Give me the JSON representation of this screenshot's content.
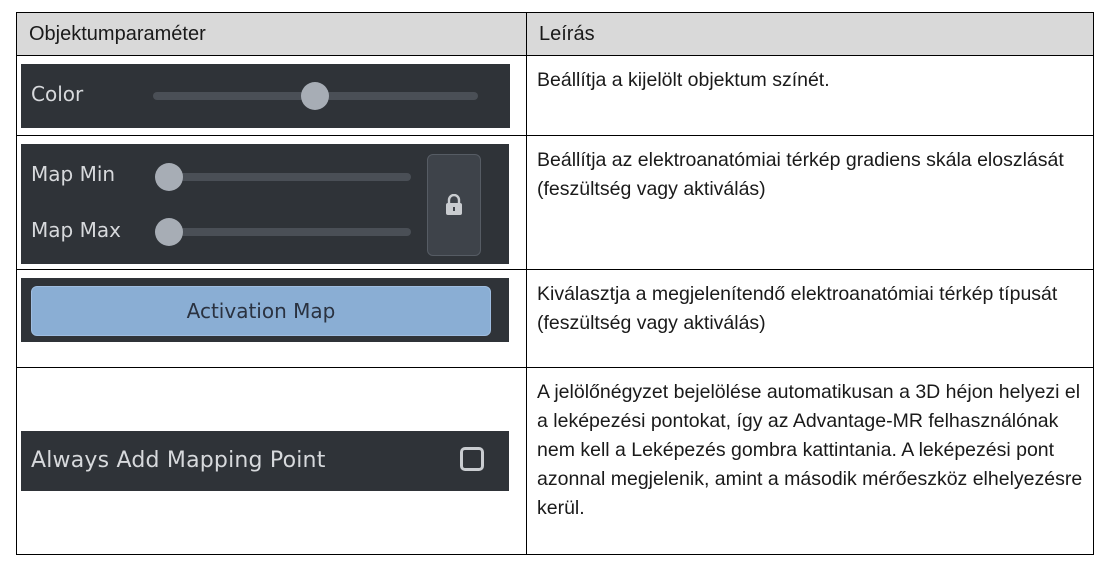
{
  "table": {
    "headers": [
      "Objektumparaméter",
      "Leírás"
    ],
    "rows": [
      {
        "panel": {
          "label": "Color",
          "slider_value": 0.5
        },
        "description": "Beállítja a kijelölt objektum színét."
      },
      {
        "panel": {
          "label_min": "Map Min",
          "label_max": "Map Max",
          "min_value": 0.0,
          "max_value": 0.0,
          "lock_icon": "lock-icon"
        },
        "description": "Beállítja az elektroanatómiai térkép gradiens skála eloszlását (feszültség vagy aktiválás)"
      },
      {
        "panel": {
          "button_label": "Activation Map"
        },
        "description": "Kiválasztja a megjelenítendő elektroanatómiai térkép típusát (feszültség vagy aktiválás)"
      },
      {
        "panel": {
          "label": "Always Add Mapping Point",
          "checked": false
        },
        "description": "A jelölőnégyzet bejelölése automatikusan a 3D héjon helyezi el a leképezési pontokat, így az Advantage-MR felhasználónak nem kell a Leképezés gombra kattintania. A leképezési pont azonnal megjelenik, amint a második mérőeszköz elhelyezésre kerül."
      }
    ]
  },
  "colors": {
    "panel_bg": "#2f3338",
    "button_blue": "#8aaed4",
    "header_bg": "#d9d9d9"
  }
}
